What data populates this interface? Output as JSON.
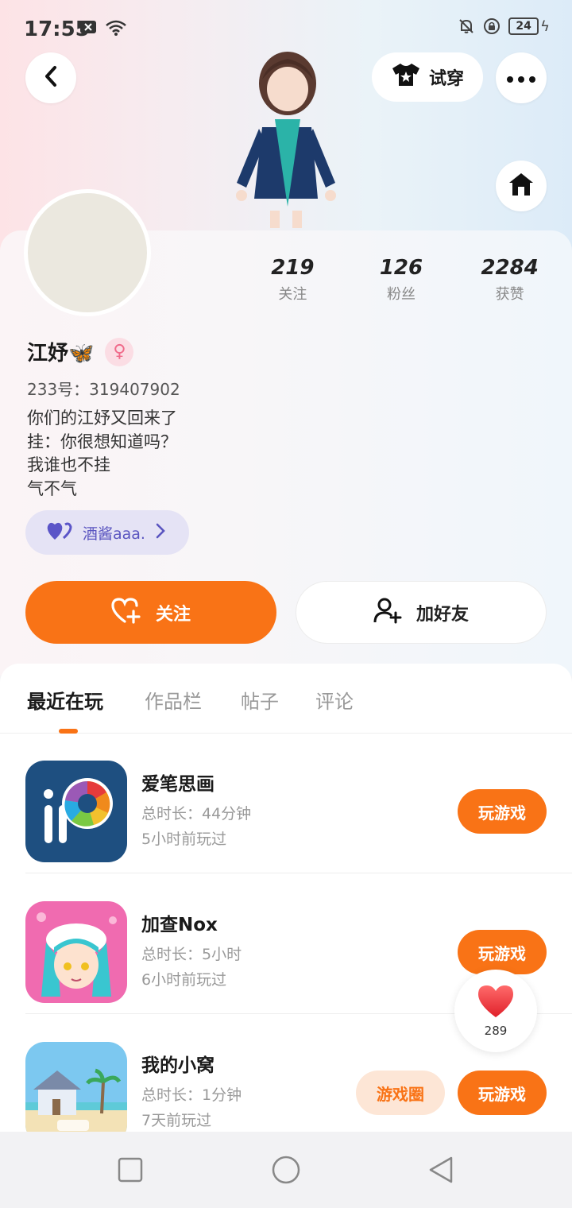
{
  "status_bar": {
    "time": "17:55",
    "battery": "24",
    "icons": [
      "close-box-icon",
      "wifi-icon",
      "mute-icon",
      "lock-rotate-icon",
      "battery-icon",
      "charging-icon"
    ]
  },
  "header": {
    "back_icon": "chevron-left-icon",
    "try_on_label": "试穿",
    "more_icon": "more-dots-icon",
    "home_icon": "home-icon"
  },
  "profile": {
    "name": "江妤🦋",
    "gender_symbol": "♀",
    "uid": "233号：319407902",
    "bio": [
      "你们的江妤又回来了",
      "挂：你很想知道吗？",
      "我谁也不挂",
      "气不气"
    ],
    "link_chip": "酒酱aaa.",
    "stats": [
      {
        "num": "219",
        "label": "关注"
      },
      {
        "num": "126",
        "label": "粉丝"
      },
      {
        "num": "2284",
        "label": "获赞"
      }
    ]
  },
  "actions": {
    "follow_label": "关注",
    "add_friend_label": "加好友"
  },
  "tabs": [
    "最近在玩",
    "作品栏",
    "帖子",
    "评论"
  ],
  "games": [
    {
      "name": "爱笔思画",
      "duration": "总时长：44分钟",
      "last_played": "5小时前玩过",
      "play_label": "玩游戏"
    },
    {
      "name": "加查Nox",
      "duration": "总时长：5小时",
      "last_played": "6小时前玩过",
      "play_label": "玩游戏"
    },
    {
      "name": "我的小窝",
      "duration": "总时长：1分钟",
      "last_played": "7天前玩过",
      "play_label": "玩游戏",
      "circle_label": "游戏圈"
    }
  ],
  "like_bubble": {
    "count": "289"
  },
  "colors": {
    "accent": "#f97316",
    "chip": "#e5e3f5"
  }
}
